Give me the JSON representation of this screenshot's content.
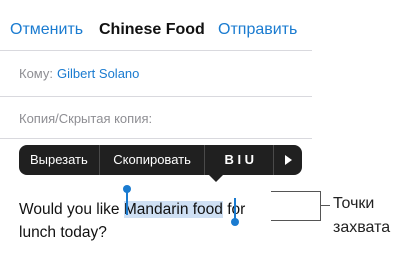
{
  "nav": {
    "cancel": "Отменить",
    "title": "Chinese Food",
    "send": "Отправить"
  },
  "fields": {
    "to_label": "Кому:",
    "to_value": "Gilbert Solano",
    "cc_label": "Копия/Скрытая копия:"
  },
  "menu": {
    "cut": "Вырезать",
    "copy": "Скопировать",
    "format": "B I U"
  },
  "message": {
    "before": "Would you like ",
    "selected": "Mandarin food",
    "after": " for",
    "line2": "lunch today?"
  },
  "callout": {
    "line1": "Точки",
    "line2": "захвата"
  },
  "colors": {
    "accent": "#1a7bd0",
    "menu_bg": "#202020",
    "selection": "#cfe0f4"
  },
  "icons": {
    "more": "play-right-icon"
  }
}
